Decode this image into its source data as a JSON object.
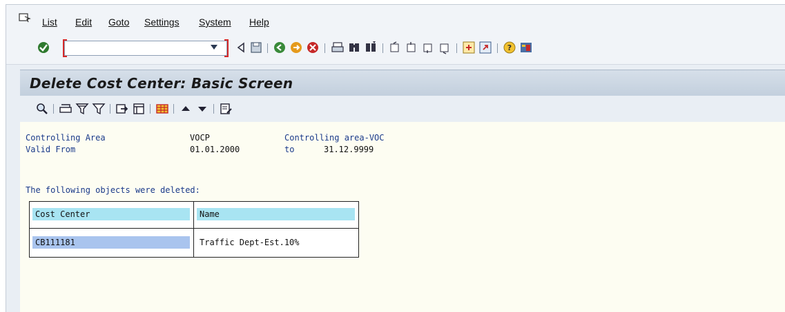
{
  "menu": {
    "items": [
      "List",
      "Edit",
      "Goto",
      "Settings",
      "System",
      "Help"
    ]
  },
  "toolbar": {
    "command_field_value": "",
    "icons": [
      "enter-icon",
      "back-icon",
      "save-icon",
      "back-green-icon",
      "exit-icon",
      "cancel-icon",
      "print-icon",
      "find-icon",
      "find-next-icon",
      "first-page-icon",
      "previous-page-icon",
      "next-page-icon",
      "last-page-icon",
      "create-session-icon",
      "shortcut-icon",
      "help-icon",
      "customize-layout-icon"
    ]
  },
  "screen": {
    "title": "Delete Cost Center: Basic Screen"
  },
  "app_toolbar": {
    "icons": [
      "details-icon",
      "print-icon",
      "filter-icon",
      "delete-filter-icon",
      "export-icon",
      "layout-icon",
      "grid-icon",
      "sort-ascending-icon",
      "sort-descending-icon",
      "notes-icon"
    ]
  },
  "header_fields": {
    "controlling_area_label": "Controlling Area",
    "controlling_area_value": "VOCP",
    "controlling_area_text": "Controlling area-VOC",
    "valid_from_label": "Valid From",
    "valid_from_value": "01.01.2000",
    "to_label": "to",
    "valid_to_value": "31.12.9999"
  },
  "result": {
    "message": "The following objects were deleted:",
    "columns": [
      "Cost Center",
      "Name"
    ],
    "rows": [
      {
        "cost_center": "CB111181",
        "name": "Traffic Dept-Est.10%"
      }
    ]
  }
}
